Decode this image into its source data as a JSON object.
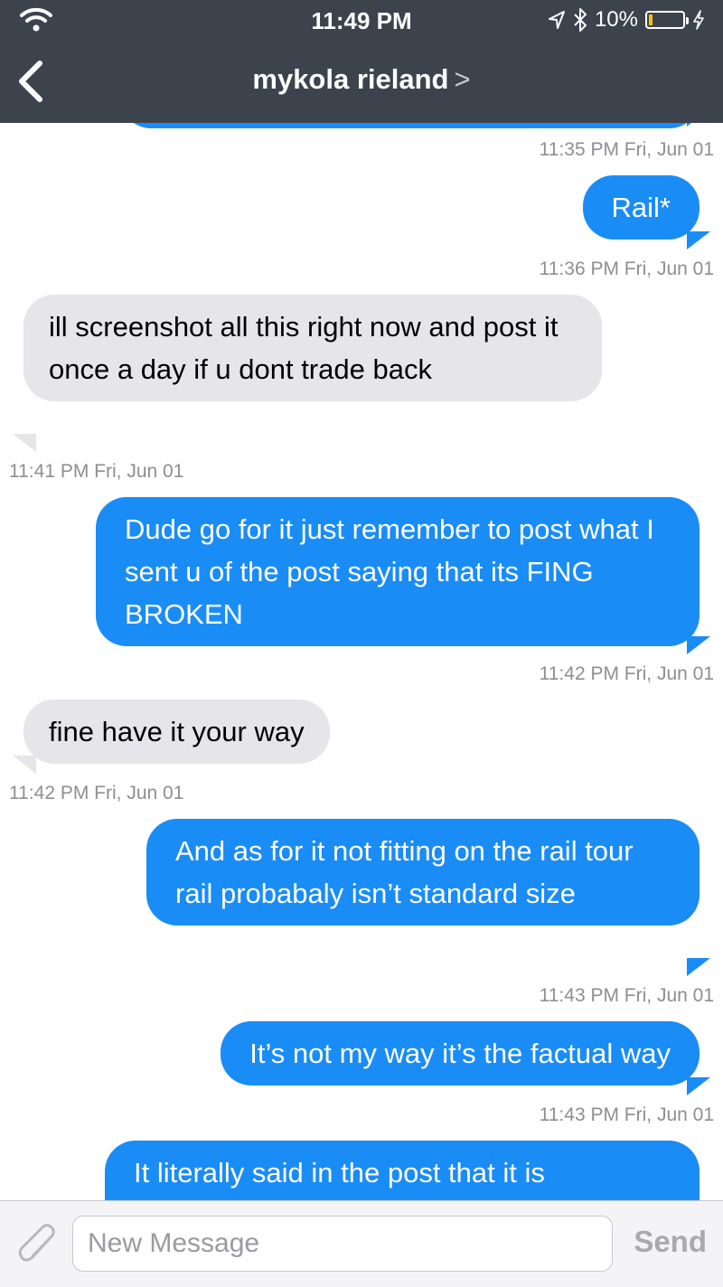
{
  "status_bar": {
    "time": "11:49 PM",
    "battery_percent": "10%",
    "battery_level": 0.1
  },
  "header": {
    "contact_name": "mykola rieland",
    "detail_chevron": ">"
  },
  "messages": [
    {
      "sender": "me",
      "text": "Rail*",
      "timestamp": "11:36 PM Fri, Jun 01"
    },
    {
      "sender": "them",
      "text": "ill screenshot all this right now and post it once a day if u dont trade back",
      "timestamp": "11:41 PM Fri, Jun 01"
    },
    {
      "sender": "me",
      "text": "Dude go for it just remember to post what I sent u of the post saying that its FING BROKEN",
      "timestamp": "11:42 PM Fri, Jun 01"
    },
    {
      "sender": "them",
      "text": "fine have it your way",
      "timestamp": "11:42 PM Fri, Jun 01"
    },
    {
      "sender": "me",
      "text": "And as for it not fitting on the rail tour rail probabaly isn’t standard size",
      "timestamp": "11:43 PM Fri, Jun 01"
    },
    {
      "sender": "me",
      "text": "It’s not my way it’s the factual way",
      "timestamp": "11:43 PM Fri, Jun 01"
    },
    {
      "sender": "me",
      "text": "It literally said in the post that it is",
      "timestamp": ""
    }
  ],
  "earlier_timestamp": "11:35 PM Fri, Jun 01",
  "composer": {
    "placeholder": "New Message",
    "send_label": "Send"
  },
  "colors": {
    "bar": "#3d434d",
    "sent_bubble": "#1a8cf6",
    "received_bubble": "#e5e5ea",
    "timestamp": "#8e8e93"
  }
}
